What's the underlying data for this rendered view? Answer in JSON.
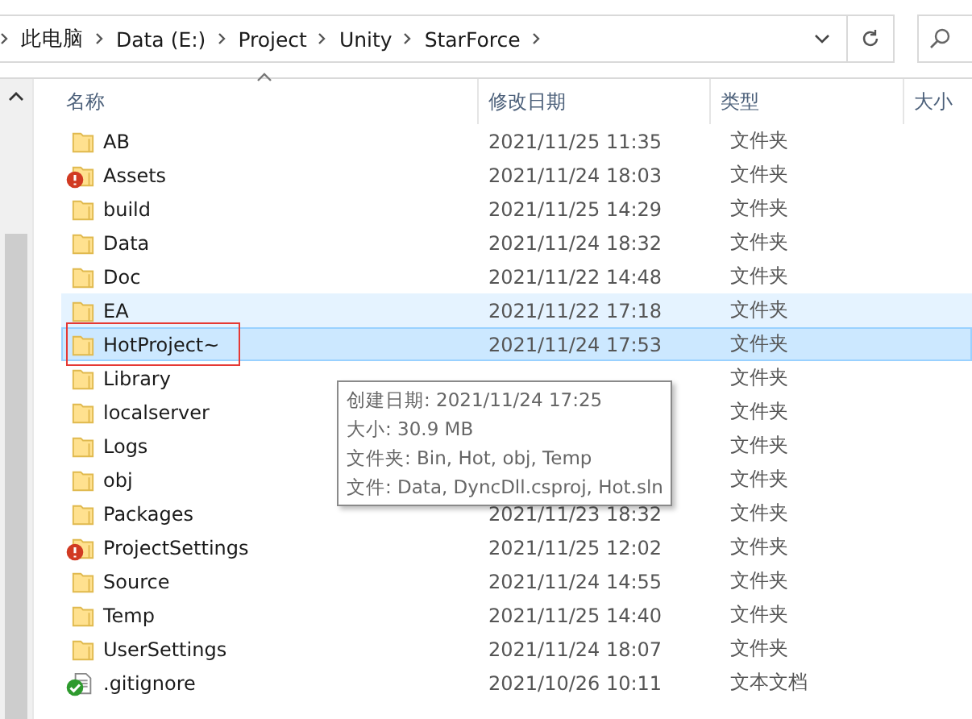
{
  "address_bar": {
    "segments": [
      "此电脑",
      "Data (E:)",
      "Project",
      "Unity",
      "StarForce"
    ]
  },
  "columns": [
    "名称",
    "修改日期",
    "类型",
    "大小"
  ],
  "rows": [
    {
      "kind": "folder",
      "name": "AB",
      "date": "2021/11/25 11:35",
      "type": "文件夹",
      "error_badge": false,
      "check_badge": false,
      "hovered": false,
      "selected": false,
      "outlined": false
    },
    {
      "kind": "folder",
      "name": "Assets",
      "date": "2021/11/24 18:03",
      "type": "文件夹",
      "error_badge": true,
      "check_badge": false,
      "hovered": false,
      "selected": false,
      "outlined": false
    },
    {
      "kind": "folder",
      "name": "build",
      "date": "2021/11/25 14:29",
      "type": "文件夹",
      "error_badge": false,
      "check_badge": false,
      "hovered": false,
      "selected": false,
      "outlined": false
    },
    {
      "kind": "folder",
      "name": "Data",
      "date": "2021/11/24 18:32",
      "type": "文件夹",
      "error_badge": false,
      "check_badge": false,
      "hovered": false,
      "selected": false,
      "outlined": false
    },
    {
      "kind": "folder",
      "name": "Doc",
      "date": "2021/11/22 14:48",
      "type": "文件夹",
      "error_badge": false,
      "check_badge": false,
      "hovered": false,
      "selected": false,
      "outlined": false
    },
    {
      "kind": "folder",
      "name": "EA",
      "date": "2021/11/22 17:18",
      "type": "文件夹",
      "error_badge": false,
      "check_badge": false,
      "hovered": true,
      "selected": false,
      "outlined": false
    },
    {
      "kind": "folder",
      "name": "HotProject~",
      "date": "2021/11/24 17:53",
      "type": "文件夹",
      "error_badge": false,
      "check_badge": false,
      "hovered": false,
      "selected": true,
      "outlined": true
    },
    {
      "kind": "folder",
      "name": "Library",
      "type": "文件夹",
      "error_badge": false,
      "check_badge": false,
      "hovered": false,
      "selected": false,
      "outlined": false
    },
    {
      "kind": "folder",
      "name": "localserver",
      "type": "文件夹",
      "error_badge": false,
      "check_badge": false,
      "hovered": false,
      "selected": false,
      "outlined": false
    },
    {
      "kind": "folder",
      "name": "Logs",
      "type": "文件夹",
      "error_badge": false,
      "check_badge": false,
      "hovered": false,
      "selected": false,
      "outlined": false
    },
    {
      "kind": "folder",
      "name": "obj",
      "type": "文件夹",
      "error_badge": false,
      "check_badge": false,
      "hovered": false,
      "selected": false,
      "outlined": false
    },
    {
      "kind": "folder",
      "name": "Packages",
      "date": "2021/11/23 18:32",
      "type": "文件夹",
      "error_badge": false,
      "check_badge": false,
      "hovered": false,
      "selected": false,
      "outlined": false
    },
    {
      "kind": "folder",
      "name": "ProjectSettings",
      "date": "2021/11/25 12:02",
      "type": "文件夹",
      "error_badge": true,
      "check_badge": false,
      "hovered": false,
      "selected": false,
      "outlined": false
    },
    {
      "kind": "folder",
      "name": "Source",
      "date": "2021/11/24 14:55",
      "type": "文件夹",
      "error_badge": false,
      "check_badge": false,
      "hovered": false,
      "selected": false,
      "outlined": false
    },
    {
      "kind": "folder",
      "name": "Temp",
      "date": "2021/11/25 14:40",
      "type": "文件夹",
      "error_badge": false,
      "check_badge": false,
      "hovered": false,
      "selected": false,
      "outlined": false
    },
    {
      "kind": "folder",
      "name": "UserSettings",
      "date": "2021/11/24 18:07",
      "type": "文件夹",
      "error_badge": false,
      "check_badge": false,
      "hovered": false,
      "selected": false,
      "outlined": false
    },
    {
      "kind": "text",
      "name": ".gitignore",
      "date": "2021/10/26 10:11",
      "type": "文本文档",
      "error_badge": false,
      "check_badge": true,
      "hovered": false,
      "selected": false,
      "outlined": false
    }
  ],
  "tooltip": {
    "lines": [
      "创建日期: 2021/11/24 17:25",
      "大小: 30.9 MB",
      "文件夹: Bin, Hot, obj, Temp",
      "文件: Data, DyncDll.csproj, Hot.sln"
    ]
  }
}
